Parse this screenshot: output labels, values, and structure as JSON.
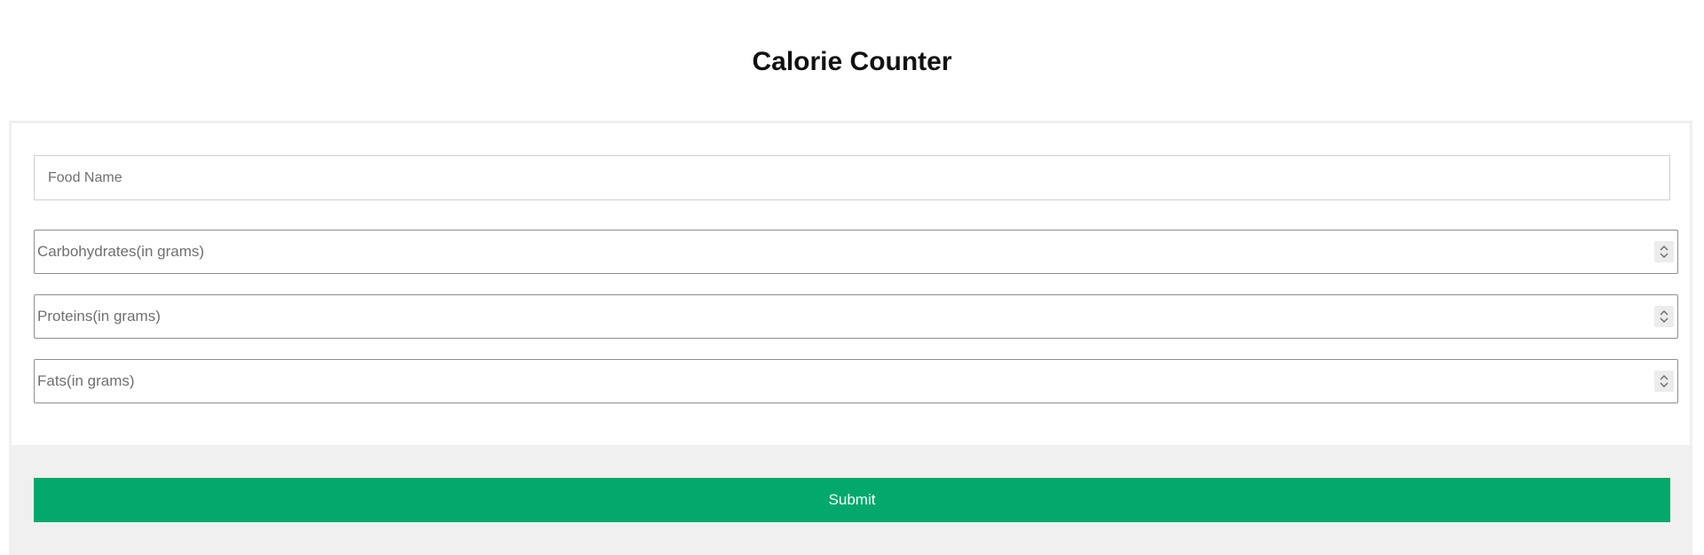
{
  "header": {
    "title": "Calorie Counter"
  },
  "form": {
    "food_name": {
      "placeholder": "Food Name",
      "value": ""
    },
    "carbohydrates": {
      "placeholder": "Carbohydrates(in grams)",
      "value": ""
    },
    "proteins": {
      "placeholder": "Proteins(in grams)",
      "value": ""
    },
    "fats": {
      "placeholder": "Fats(in grams)",
      "value": ""
    },
    "submit_label": "Submit"
  },
  "icons": {
    "spinner": "up-down-chevron-icon"
  },
  "colors": {
    "submit_background": "#03a96b",
    "submit_text": "#ffffff",
    "footer_background": "#f0f0f0",
    "title_text": "#111111"
  }
}
